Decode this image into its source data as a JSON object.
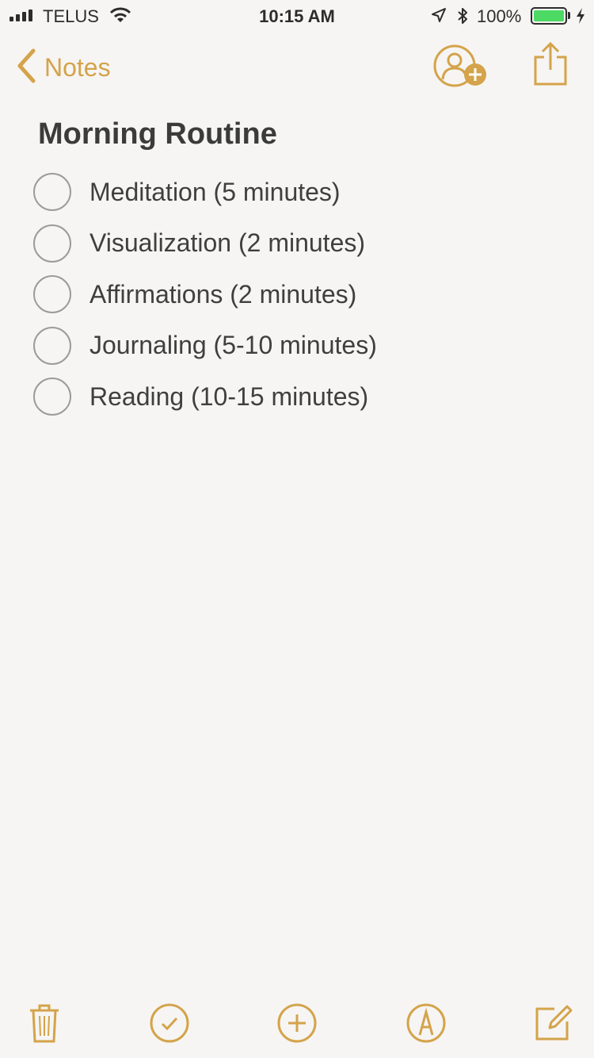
{
  "status_bar": {
    "carrier": "TELUS",
    "time": "10:15 AM",
    "battery_percent": "100%",
    "battery_level": 1.0,
    "battery_color": "#4cd964"
  },
  "nav": {
    "back_label": "Notes",
    "back_icon": "chevron-left-icon",
    "collab_icon": "add-person-icon",
    "share_icon": "share-icon",
    "accent_color": "#d4a34a"
  },
  "note": {
    "title": "Morning Routine",
    "items": [
      {
        "text": "Meditation (5 minutes)",
        "checked": false
      },
      {
        "text": "Visualization (2 minutes)",
        "checked": false
      },
      {
        "text": "Affirmations (2 minutes)",
        "checked": false
      },
      {
        "text": "Journaling (5-10 minutes)",
        "checked": false
      },
      {
        "text": "Reading (10-15 minutes)",
        "checked": false
      }
    ]
  },
  "toolbar": {
    "icons": [
      "trash-icon",
      "checklist-icon",
      "add-icon",
      "markup-icon",
      "compose-icon"
    ]
  }
}
